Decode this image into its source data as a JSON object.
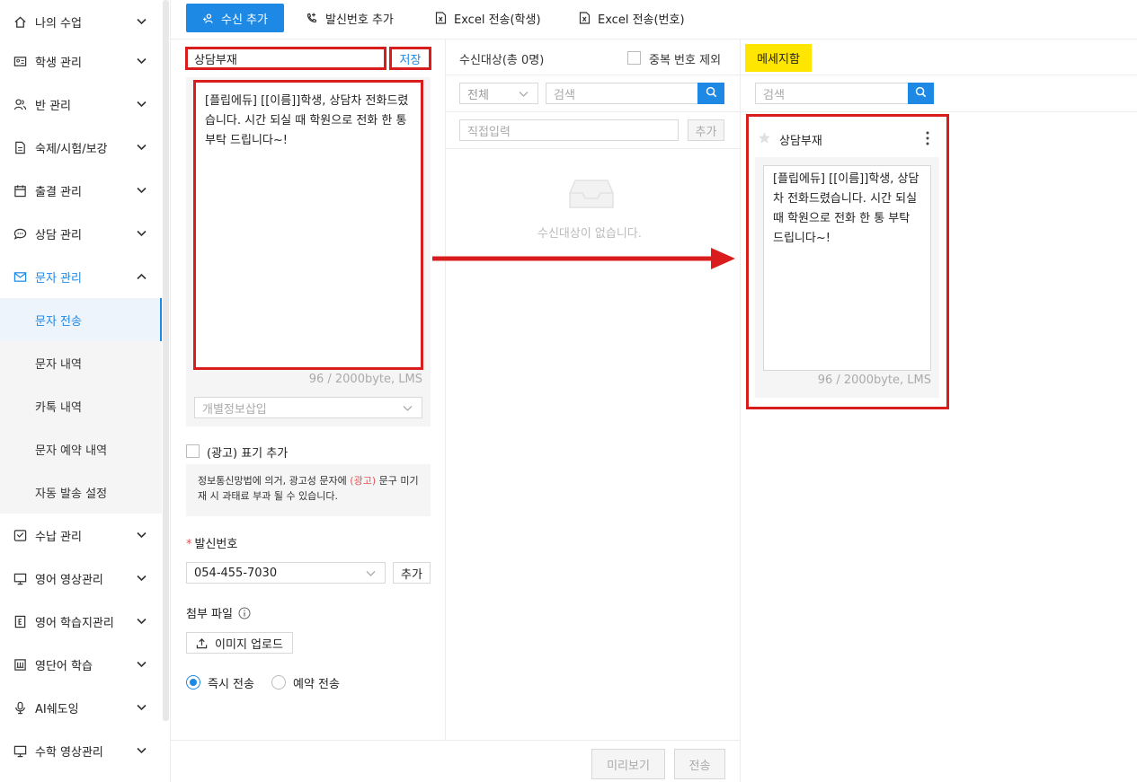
{
  "sidebar": {
    "items": [
      {
        "label": "나의 수업",
        "icon": "home-icon"
      },
      {
        "label": "학생 관리",
        "icon": "id-card-icon"
      },
      {
        "label": "반 관리",
        "icon": "users-icon"
      },
      {
        "label": "숙제/시험/보강",
        "icon": "document-icon"
      },
      {
        "label": "출결 관리",
        "icon": "calendar-icon"
      },
      {
        "label": "상담 관리",
        "icon": "chat-icon"
      },
      {
        "label": "문자 관리",
        "icon": "mail-icon"
      },
      {
        "label": "수납 관리",
        "icon": "inbox-icon"
      },
      {
        "label": "영어 영상관리",
        "icon": "monitor-icon"
      },
      {
        "label": "영어 학습지관리",
        "icon": "book-e-icon"
      },
      {
        "label": "영단어 학습",
        "icon": "keyboard-icon"
      },
      {
        "label": "AI쉐도잉",
        "icon": "mic-icon"
      },
      {
        "label": "수학 영상관리",
        "icon": "monitor-icon"
      }
    ],
    "sub_items": [
      "문자 전송",
      "문자 내역",
      "카톡 내역",
      "문자 예약 내역",
      "자동 발송 설정"
    ]
  },
  "toolbar": {
    "add_recipient": "수신 추가",
    "add_sender": "발신번호 추가",
    "excel_student": "Excel 전송(학생)",
    "excel_number": "Excel 전송(번호)"
  },
  "compose": {
    "title_value": "상담부재",
    "save_label": "저장",
    "message": "[플립에듀] [[이름]]학생, 상담차 전화드렸습니다. 시간 되실 때 학원으로 전화 한 통 부탁 드립니다~!",
    "byte_count": "96 / 2000byte, LMS",
    "personal_info_placeholder": "개별정보삽입",
    "ad_label": "(광고) 표기 추가",
    "ad_notice_pre": "정보통신망법에 의거, 광고성 문자에 ",
    "ad_notice_red": "(광고)",
    "ad_notice_post": " 문구 미기재 시 과태료 부과 될 수 있습니다.",
    "sender_star": "*",
    "sender_label": "발신번호",
    "sender_value": "054-455-7030",
    "sender_add": "추가",
    "attach_label": "첨부 파일",
    "upload_label": "이미지 업로드",
    "send_now": "즉시 전송",
    "send_reserved": "예약 전송"
  },
  "recipients": {
    "title": "수신대상(총 0명)",
    "exclude_dup": "중복 번호 제외",
    "scope_value": "전체",
    "search_placeholder": "검색",
    "direct_placeholder": "직접입력",
    "direct_add": "추가",
    "empty_text": "수신대상이 없습니다.",
    "preview_label": "미리보기",
    "send_label": "전송"
  },
  "message_box": {
    "tab_label": "메세지함",
    "search_placeholder": "검색",
    "card_title": "상담부재",
    "card_text": "[플립에듀] [[이름]]학생, 상담차 전화드렸습니다. 시간 되실 때 학원으로 전화 한 통 부탁 드립니다~!",
    "card_bytes": "96 / 2000byte, LMS"
  },
  "colors": {
    "accent": "#1e88e5",
    "highlight": "#d91c1c",
    "tab_yellow": "#ffe600"
  }
}
